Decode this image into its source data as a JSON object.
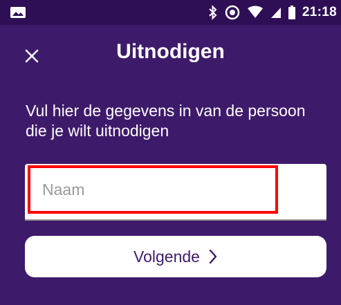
{
  "status_bar": {
    "time": "21:18",
    "icons": [
      "image-icon",
      "bluetooth-icon",
      "do-not-disturb-icon",
      "wifi-icon",
      "signal-icon",
      "battery-icon"
    ]
  },
  "header": {
    "title": "Uitnodigen",
    "close_icon": "close-icon"
  },
  "form": {
    "instruction": "Vul hier de gegevens in van de persoon die je wilt uitnodigen",
    "name_input": {
      "placeholder": "Naam",
      "value": ""
    },
    "next_button": {
      "label": "Volgende",
      "icon": "chevron-right-icon"
    }
  },
  "colors": {
    "background": "#3e1a6b",
    "status_bar": "#2e0f55",
    "highlight": "#ff0000",
    "button_text": "#3e1a6b"
  }
}
